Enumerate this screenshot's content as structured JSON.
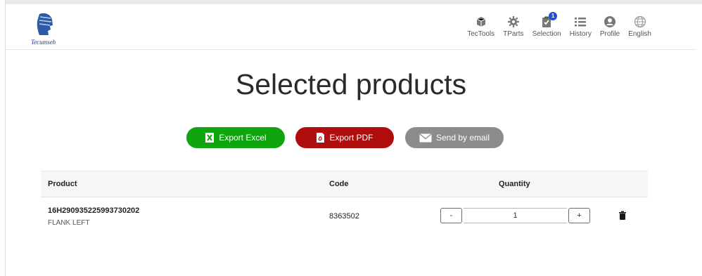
{
  "brand": {
    "name": "Tecumseh"
  },
  "nav": {
    "items": [
      {
        "label": "TecTools",
        "icon": "box-icon"
      },
      {
        "label": "TParts",
        "icon": "gear-icon"
      },
      {
        "label": "Selection",
        "icon": "clipboard-check-icon",
        "badge": "1"
      },
      {
        "label": "History",
        "icon": "list-icon"
      },
      {
        "label": "Profile",
        "icon": "user-icon"
      },
      {
        "label": "English",
        "icon": "globe-icon"
      }
    ]
  },
  "page": {
    "title": "Selected products"
  },
  "actions": {
    "excel_label": "Export Excel",
    "pdf_label": "Export PDF",
    "email_label": "Send by email"
  },
  "table": {
    "headers": {
      "product": "Product",
      "code": "Code",
      "quantity": "Quantity"
    },
    "rows": [
      {
        "product": "16H290935225993730202",
        "description": "FLANK LEFT",
        "code": "8363502",
        "quantity": "1",
        "minus": "-",
        "plus": "+"
      }
    ]
  },
  "colors": {
    "excel": "#0ea50e",
    "pdf": "#b00d0d",
    "email": "#8c8c8c",
    "badge": "#1f4fd8"
  }
}
